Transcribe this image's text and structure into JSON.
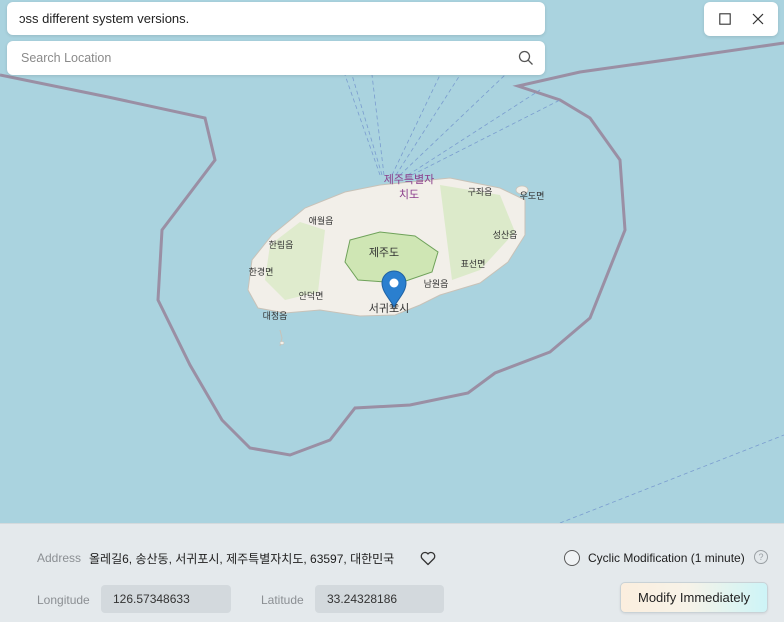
{
  "banner": {
    "text": "ɔss different system versions."
  },
  "search": {
    "placeholder": "Search Location",
    "icon": "search-icon"
  },
  "window": {
    "maximize_icon": "maximize-icon",
    "close_icon": "close-icon"
  },
  "map": {
    "island_name": "제주도",
    "labels": {
      "jeju_1": "제주특별자",
      "jeju_2": "치도",
      "jocheon": "구좌읍",
      "udo": "우도면",
      "aewol": "애월읍",
      "seongsan": "성산읍",
      "hallim": "한림읍",
      "pyoseon": "표선면",
      "hangyeong": "한경면",
      "namwon": "남원읍",
      "andeok": "안덕면",
      "seogwipo": "서귀포시",
      "daejeong": "대정읍"
    },
    "colors": {
      "sea": "#aad3df",
      "land": "#f2efe9",
      "park": "#cfe6b4",
      "boundary": "#9a8fa4",
      "marker": "#2a7fcf"
    }
  },
  "panel": {
    "address_label": "Address",
    "address_value": "올레길6, 송산동, 서귀포시, 제주특별자치도, 63597, 대한민국",
    "favorite_icon": "heart-icon",
    "cyclic_label": "Cyclic Modification (1 minute)",
    "help_glyph": "?",
    "longitude_label": "Longitude",
    "longitude_value": "126.57348633",
    "latitude_label": "Latitude",
    "latitude_value": "33.24328186",
    "modify_button": "Modify Immediately"
  }
}
